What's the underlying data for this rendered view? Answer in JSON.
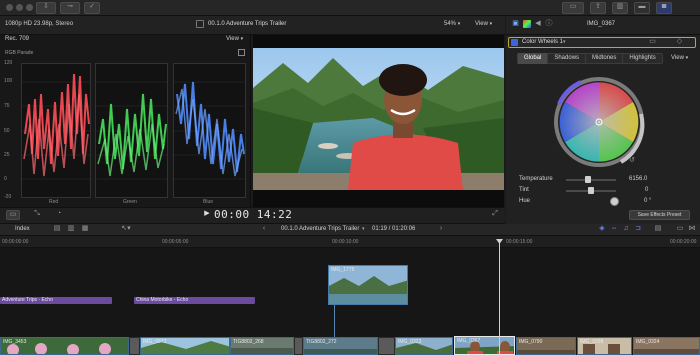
{
  "top_bar": {
    "format": "1080p HD 23.98p, Stereo",
    "project_title": "00.1.0 Adventure Trips Trailer",
    "zoom": "54%",
    "view_menu": "View",
    "inspector_clip": "IMG_0367"
  },
  "scopes": {
    "standard": "Rec. 709",
    "view_menu": "View",
    "mode": "RGB Parade",
    "axis_ticks": [
      "120",
      "100",
      "75",
      "50",
      "25",
      "0",
      "-20"
    ],
    "channels": [
      "Red",
      "Green",
      "Blue"
    ],
    "colors": {
      "red": "#ff4f58",
      "green": "#47e05a",
      "blue": "#4f8cff"
    }
  },
  "viewer": {
    "timecode": "00:00 14:22"
  },
  "inspector": {
    "effect_name": "Color Wheels 1",
    "tabs": [
      "Global",
      "Shadows",
      "Midtones",
      "Highlights"
    ],
    "active_tab": "Global",
    "view_menu": "View",
    "params": [
      {
        "name": "Temperature",
        "value": "6156.0"
      },
      {
        "name": "Tint",
        "value": "0"
      },
      {
        "name": "Hue",
        "value": "0 °"
      }
    ],
    "save_button": "Save Effects Preset"
  },
  "timeline_bar": {
    "index": "Index",
    "project": "00.1.0 Adventure Trips Trailer",
    "duration": "01:19 / 01:20:06"
  },
  "ruler": [
    "00:00:00:00",
    "00:00:05:00",
    "00:00:10:00",
    "00:00:15:00",
    "00:00:20:00"
  ],
  "timeline": {
    "connected_clip": "IMG_1775",
    "audio_bars": [
      "Adventure Trips - Echo",
      "China Motorbike - Echo"
    ],
    "clips": [
      "IMG_3453",
      "IMG_0873",
      "TIG8802_268",
      "TIG8802_272",
      "IMG_0323",
      "IMG_0367",
      "IMG_0790",
      "IMG_0298",
      "IMG_0324"
    ]
  }
}
